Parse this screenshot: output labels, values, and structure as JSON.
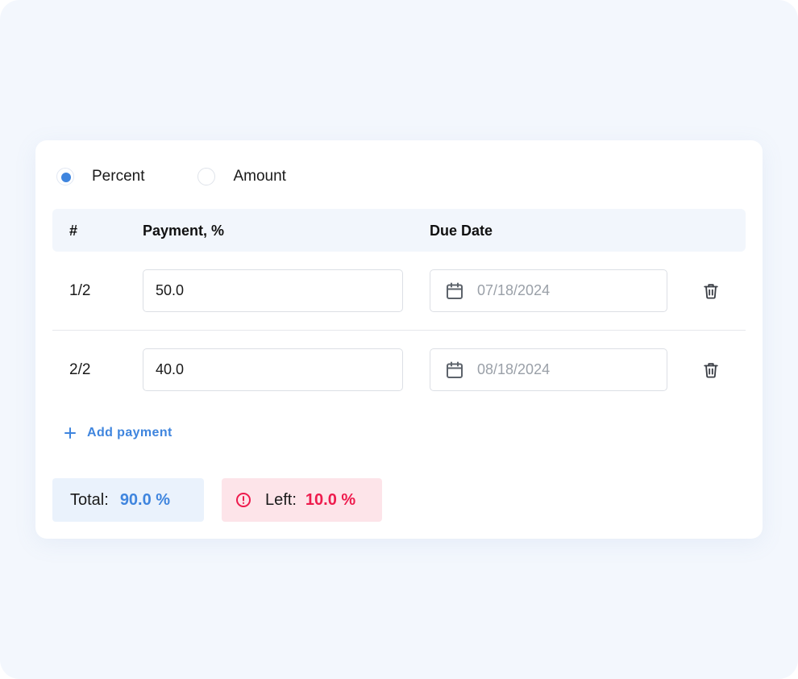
{
  "mode": {
    "options": [
      {
        "label": "Percent",
        "checked": true
      },
      {
        "label": "Amount",
        "checked": false
      }
    ]
  },
  "table": {
    "headers": {
      "index": "#",
      "payment": "Payment, %",
      "due_date": "Due Date"
    },
    "rows": [
      {
        "index": "1/2",
        "payment": "50.0",
        "due_date": "07/18/2024"
      },
      {
        "index": "2/2",
        "payment": "40.0",
        "due_date": "08/18/2024"
      }
    ]
  },
  "actions": {
    "add_payment_label": "Add payment"
  },
  "summary": {
    "total_label": "Total:",
    "total_value": "90.0 %",
    "left_label": "Left:",
    "left_value": "10.0 %"
  },
  "icons": {
    "row_date": "calendar-icon",
    "row_delete": "trash-icon",
    "add": "plus-icon",
    "warning": "alert-circle-icon"
  },
  "colors": {
    "accent": "#3f85de",
    "danger": "#ee1b4d",
    "danger_bg": "#fde4e9",
    "total_bg": "#eaf2fc",
    "header_bg": "#f2f6fc",
    "page_bg": "#f3f7fd"
  }
}
